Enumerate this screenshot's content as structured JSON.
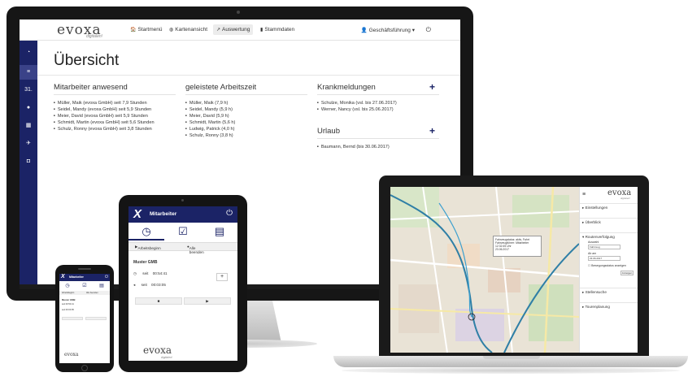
{
  "monitor": {
    "logo": "evoxa",
    "logo_sub": "digitalen!",
    "nav": {
      "startmenu": "Startmenü",
      "kartenansicht": "Kartenansicht",
      "auswertung": "Auswertung",
      "stammdaten": "Stammdaten",
      "user": "Geschäftsführung ▾"
    },
    "sidebar_icons": [
      "gauge-icon",
      "list-icon",
      "calendar-icon",
      "location-icon",
      "table-icon",
      "plane-icon",
      "box-icon"
    ],
    "sidebar_calendar_label": "31.",
    "page_title": "Übersicht",
    "columns": {
      "anwesend": {
        "title": "Mitarbeiter anwesend",
        "items": [
          "Müller, Maik (evoxa GmbH) seit 7,9 Stunden",
          "Seidel, Mandy (evoxa GmbH) seit 5,9 Stunden",
          "Meier, David (evoxa GmbH) seit 5,9 Stunden",
          "Schmidt, Martin (evoxa GmbH) seit 5,6 Stunden",
          "Schulz, Ronny (evoxa GmbH) seit 3,8 Stunden"
        ]
      },
      "arbeitszeit": {
        "title": "geleistete Arbeitszeit",
        "items": [
          "Müller, Maik (7,9 h)",
          "Seidel, Mandy (5,9 h)",
          "Meier, David (5,9 h)",
          "Schmidt, Martin (5,6 h)",
          "Ludwig, Patrick (4,0 h)",
          "Schulz, Ronny (3,8 h)"
        ]
      },
      "krankmeldungen": {
        "title": "Krankmeldungen",
        "items": [
          "Schulze, Monika (vsl. bis 27.06.2017)",
          "Werner, Nancy (vsl. bis 25.06.2017)"
        ]
      },
      "urlaub": {
        "title": "Urlaub",
        "items": [
          "Baumann, Bernd (bis 30.06.2017)"
        ]
      }
    },
    "plus": "+"
  },
  "laptop": {
    "logo": "evoxa",
    "logo_sub": "digitalen!",
    "menu": "≡",
    "sections": {
      "einstellungen": "Einstellungen",
      "uberblick": "Überblick",
      "routenverfolgung": "Routenverfolgung",
      "stellensuche": "Stellensuche",
      "tourenplanung": "Tourenplanung"
    },
    "route": {
      "auswahl_label": "Auswahl",
      "auswahl_value": "Fahrzeug",
      "ab_label": "Ab am",
      "ab_value": "23.06.2017",
      "check_label": "Bewegungsstatus anzeigen",
      "button": "Anzeigen"
    },
    "popup_lines": [
      "Fahrzeugstatus: aktiv, Fahrt",
      "Fahrzeugführer: Mitarbeiter",
      "12:32:45 Uhr",
      "23.06.2017"
    ]
  },
  "tablet": {
    "header_title": "Mitarbeiter",
    "logo_mark": "X",
    "icons": [
      "clock-icon",
      "checkbox-icon",
      "clipboard-icon"
    ],
    "actions": {
      "start": "Arbeitsbeginn",
      "stop": "Alle beenden"
    },
    "employee": "Muster GMB",
    "rows": [
      {
        "label": "seit",
        "value": "00:54:41"
      },
      {
        "label": "seit",
        "value": "00:03:05"
      }
    ],
    "plus": "+",
    "controls": [
      "■",
      "▶"
    ],
    "logo": "evoxa",
    "logo_sub": "digitalen!"
  },
  "phone": {
    "header_title": "Mitarbeiter",
    "logo_mark": "X",
    "actions": {
      "start": "Arbeitsbeginn",
      "stop": "Alle beenden"
    },
    "employee": "Muster GMB",
    "rows": [
      {
        "label": "seit",
        "value": "00:54:41"
      },
      {
        "label": "seit",
        "value": "00:03:05"
      }
    ],
    "logo": "evoxa"
  },
  "colors": {
    "brand_navy": "#1b2366",
    "brand_navy_active": "#3a4288"
  }
}
